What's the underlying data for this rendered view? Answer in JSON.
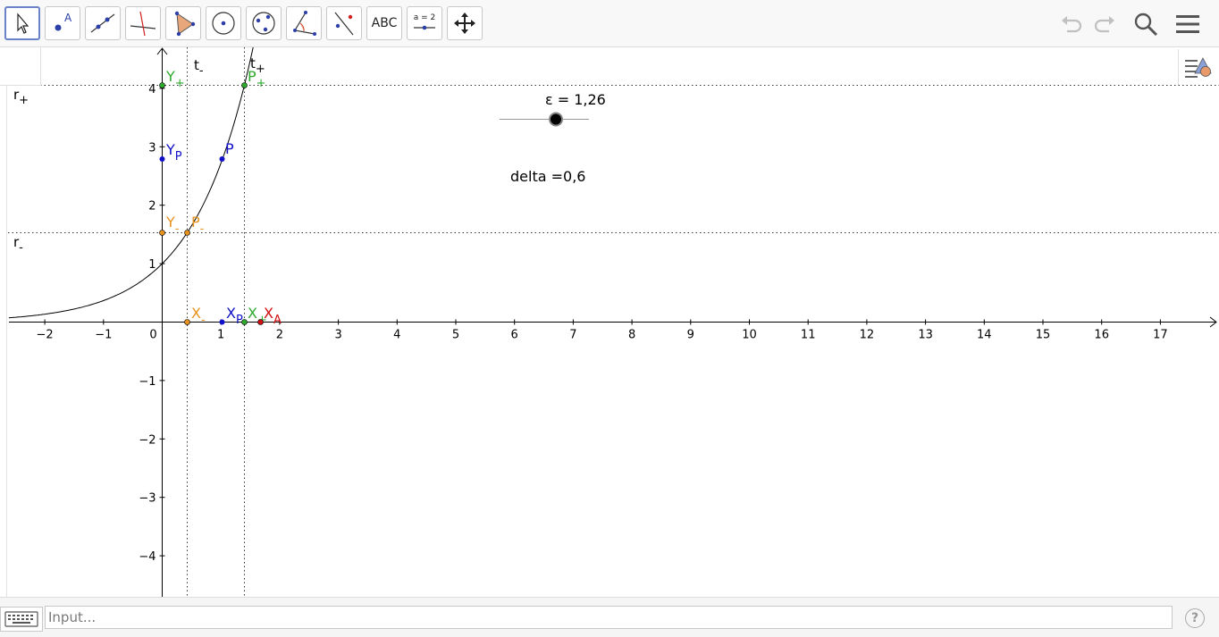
{
  "toolbar": {
    "tools": [
      {
        "name": "move-tool",
        "label": ""
      },
      {
        "name": "point-tool",
        "label": "A"
      },
      {
        "name": "line-tool",
        "label": ""
      },
      {
        "name": "perpendicular-line-tool",
        "label": ""
      },
      {
        "name": "polygon-tool",
        "label": ""
      },
      {
        "name": "circle-center-point-tool",
        "label": ""
      },
      {
        "name": "ellipse-tool",
        "label": ""
      },
      {
        "name": "angle-tool",
        "label": ""
      },
      {
        "name": "reflect-tool",
        "label": ""
      },
      {
        "name": "text-tool",
        "label": "ABC"
      },
      {
        "name": "slider-tool",
        "label": "a = 2"
      },
      {
        "name": "move-graphics-view-tool",
        "label": ""
      }
    ]
  },
  "graphics": {
    "x_ticks": [
      "−2",
      "−1",
      "0",
      "1",
      "2",
      "3",
      "4",
      "5",
      "6",
      "7",
      "8",
      "9",
      "10",
      "11",
      "12",
      "13",
      "14",
      "15",
      "16",
      "17"
    ],
    "y_ticks_pos": [
      "1",
      "2",
      "3",
      "4"
    ],
    "y_ticks_neg": [
      "−1",
      "−2",
      "−3",
      "−4"
    ],
    "labels": {
      "r_plus": "r",
      "r_plus_sub": "+",
      "r_minus": "r",
      "r_minus_sub": "-",
      "t_minus": "t",
      "t_minus_sub": "-",
      "t_plus": "t",
      "t_plus_sub": "+",
      "y_plus": "Y",
      "y_plus_sub": "+",
      "p_plus": "P",
      "p_plus_sub": "+",
      "y_p": "Y",
      "y_p_sub": "P",
      "p": "P",
      "y_minus": "Y",
      "y_minus_sub": "-",
      "p_minus": "P",
      "p_minus_sub": "-",
      "x_minus": "X",
      "x_minus_sub": "-",
      "x_p": "X",
      "x_p_sub": "P",
      "x_plus": "X",
      "x_plus_sub": "+",
      "x_a": "X",
      "x_a_sub": "A"
    },
    "slider_label": "ε = 1,26",
    "slider_value": 0.63,
    "delta_text": "delta =0,6",
    "colors": {
      "green": "#2eaa2e",
      "blue": "#1010c8",
      "orange": "#e8921e",
      "red": "#d01010",
      "axis": "#000000"
    }
  },
  "input": {
    "placeholder": "Input..."
  },
  "help": "?"
}
